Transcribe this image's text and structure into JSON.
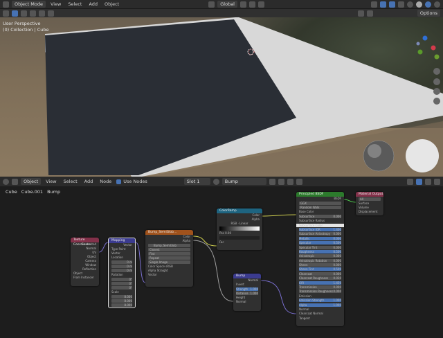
{
  "topbar": {
    "mode": "Object Mode",
    "menus": [
      "View",
      "Select",
      "Add",
      "Object"
    ],
    "transform": "Global"
  },
  "viewport": {
    "options": "Options",
    "perspective": "User Perspective",
    "collection": "(0) Collection | Cube"
  },
  "nodeeditor": {
    "mode": "Object",
    "menus": [
      "View",
      "Select",
      "Add",
      "Node"
    ],
    "use_nodes": "Use Nodes",
    "slot": "Slot 1",
    "material": "Bump",
    "breadcrumbs": [
      "Cube",
      "Cube.001",
      "Bump"
    ]
  },
  "nodes": {
    "texcoord": {
      "title": "Texture Coordinate",
      "outputs": [
        "Generated",
        "Normal",
        "UV",
        "Object",
        "Camera",
        "Window",
        "Reflection"
      ],
      "object": "Object",
      "from_instancer": "From Instancer"
    },
    "mapping": {
      "title": "Mapping",
      "out": "Vector",
      "type_label": "Type",
      "type": "Point",
      "vector": "Vector",
      "location": "Location",
      "loc": [
        "0 m",
        "0 m",
        "0 m"
      ],
      "rotation": "Rotation",
      "rot": [
        "0°",
        "0°",
        "0°"
      ],
      "scale": "Scale",
      "scl": [
        "8.000",
        "8.000",
        "8.000"
      ]
    },
    "image": {
      "title": "Bump_SemiGlob...",
      "outputs": [
        "Color",
        "Alpha"
      ],
      "filename": "Bump_SemiGlob",
      "interp": "Closest",
      "proj": "Flat",
      "ext": "Repeat",
      "src": "Single Image",
      "cs_label": "Color Space",
      "cs": "sRGB",
      "alpha_label": "Alpha",
      "alpha": "Straight",
      "vector": "Vector"
    },
    "colorramp": {
      "title": "ColorRamp",
      "outputs": [
        "Color",
        "Alpha"
      ],
      "mode": "RGB",
      "interp": "Linear",
      "pos_label": "Pos",
      "pos": "0.00",
      "fac": "Fac"
    },
    "bump": {
      "title": "Bump",
      "out": "Normal",
      "invert": "Invert",
      "strength": "Strength",
      "strength_val": "1.000",
      "distance": "Distance",
      "distance_val": "1.000",
      "height": "Height",
      "normal": "Normal"
    },
    "principled": {
      "title": "Principled BSDF",
      "out": "BSDF",
      "dist": "GGX",
      "sss": "Random Walk",
      "rows": [
        "Base Color",
        "Subsurface",
        "Subsurface Radius",
        "Subsurface Color",
        "Subsurface IOR",
        "Subsurface Anisotropy",
        "Metallic",
        "Specular",
        "Specular Tint",
        "Roughness",
        "Anisotropic",
        "Anisotropic Rotation",
        "Sheen",
        "Sheen Tint",
        "Clearcoat",
        "Clearcoat Roughness",
        "IOR",
        "Transmission",
        "Transmission Roughness",
        "Emission",
        "Emission Strength",
        "Alpha",
        "Normal",
        "Clearcoat Normal",
        "Tangent"
      ],
      "values": [
        "",
        "0.000",
        "",
        "",
        "1.400",
        "0.000",
        "0.000",
        "0.500",
        "0.000",
        "0.500",
        "0.000",
        "0.000",
        "0.000",
        "0.500",
        "0.000",
        "0.030",
        "1.450",
        "0.000",
        "0.000",
        "",
        "1.000",
        "1.000",
        "",
        "",
        ""
      ]
    },
    "output": {
      "title": "Material Output",
      "target": "All",
      "inputs": [
        "Surface",
        "Volume",
        "Displacement"
      ]
    }
  },
  "colors": {
    "texcoord_header": "#83314a",
    "mapping_header": "#3b3b8f",
    "image_header": "#a0521c",
    "colorramp_header": "#1e6480",
    "bump_header": "#3b3b8f",
    "principled_header": "#2c7a2c",
    "output_header": "#83314a"
  }
}
